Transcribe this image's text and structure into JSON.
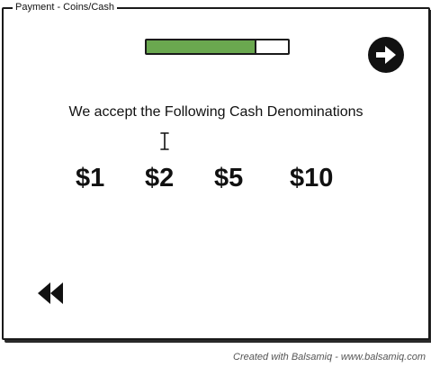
{
  "window": {
    "title": "Payment - Coins/Cash"
  },
  "progress": {
    "percent": 78,
    "fill_color": "#6aa84f"
  },
  "next_button": {
    "icon": "arrow-right-circle-icon"
  },
  "content": {
    "heading": "We accept the Following Cash Denominations",
    "denominations": [
      "$1",
      "$2",
      "$5",
      "$10"
    ]
  },
  "back_button": {
    "icon": "rewind-icon"
  },
  "footer": {
    "credit": "Created with Balsamiq - www.balsamiq.com"
  }
}
